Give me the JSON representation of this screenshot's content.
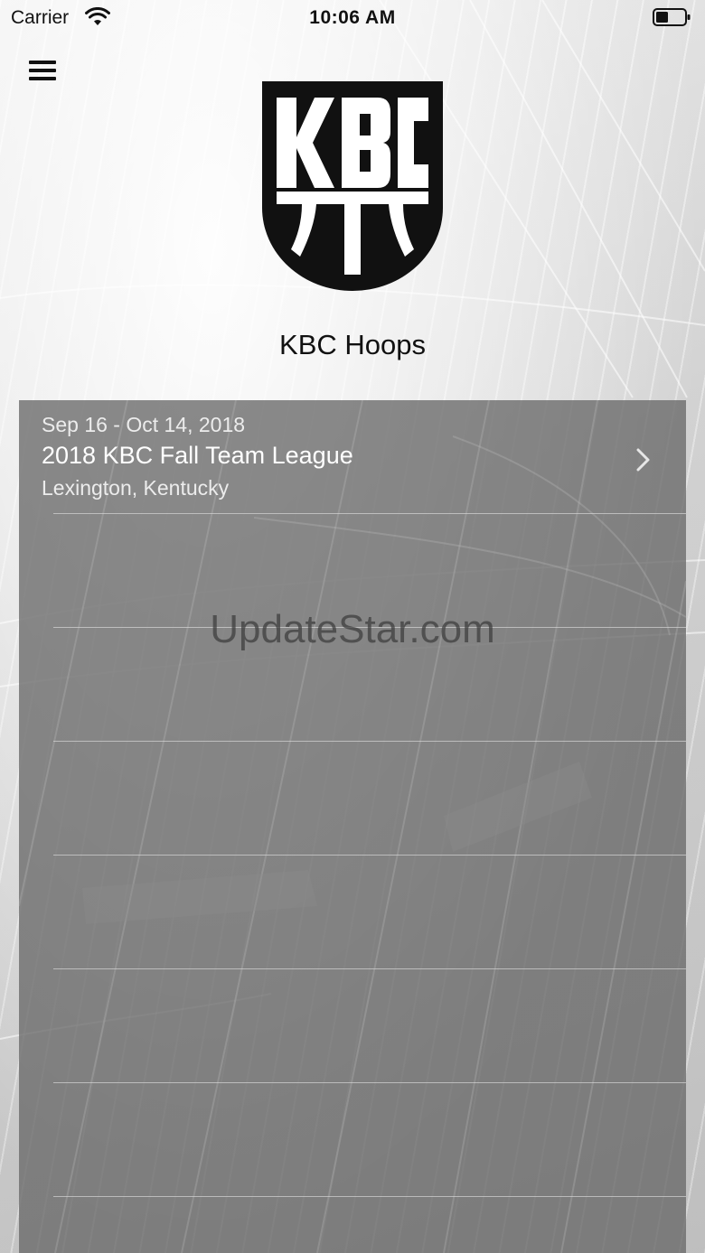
{
  "status_bar": {
    "carrier": "Carrier",
    "time": "10:06 AM",
    "icons": [
      "wifi-icon",
      "battery-icon"
    ]
  },
  "header": {
    "menu_icon": "hamburger-menu-icon",
    "logo_text": "KBC",
    "title": "KBC Hoops"
  },
  "events": [
    {
      "dates": "Sep 16 - Oct 14, 2018",
      "name": "2018 KBC Fall Team League",
      "location": "Lexington, Kentucky",
      "icon": "chevron-right-icon"
    }
  ],
  "watermark": "UpdateStar.com",
  "colors": {
    "panel": "#6a6a6a",
    "text_light": "#ffffff",
    "logo": "#111111"
  }
}
